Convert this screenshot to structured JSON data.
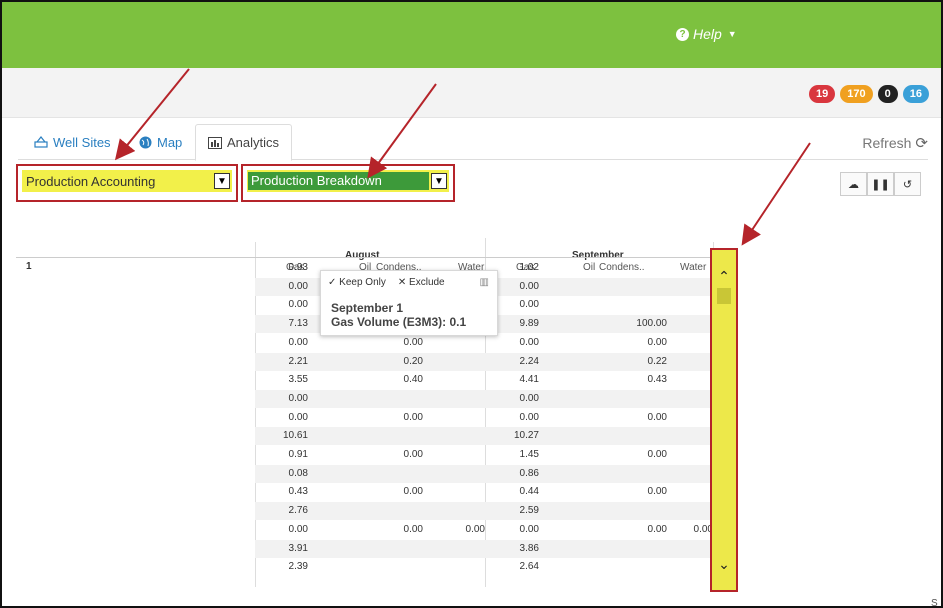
{
  "header": {
    "help_label": "Help",
    "help_icon": "question-circle-icon"
  },
  "badges": [
    {
      "value": "19",
      "color": "#d9363e"
    },
    {
      "value": "170",
      "color": "#f0a020"
    },
    {
      "value": "0",
      "color": "#222222"
    },
    {
      "value": "16",
      "color": "#3aa0d8"
    }
  ],
  "tabs": [
    {
      "label": "Well Sites",
      "icon": "well-icon"
    },
    {
      "label": "Map",
      "icon": "globe-icon"
    },
    {
      "label": "Analytics",
      "icon": "bar-chart-icon",
      "active": true
    }
  ],
  "refresh_label": "Refresh",
  "dropdowns": {
    "report": "Production Accounting",
    "view": "Production Breakdown"
  },
  "colors": {
    "highlight_yellow": "#f2f04a",
    "highlight_green": "#3d9a3a",
    "annotation_red": "#b5242a",
    "brand_green": "#7dc13f"
  },
  "grid": {
    "months": [
      "August",
      "September"
    ],
    "columns": [
      "Gas",
      "Oil",
      "Condens..",
      "Water"
    ],
    "row_label": "1",
    "rows": [
      {
        "aug": [
          "0.93",
          "",
          "",
          ""
        ],
        "sep": [
          "1.02",
          "",
          "",
          ""
        ]
      },
      {
        "aug": [
          "0.00",
          "",
          "",
          ""
        ],
        "sep": [
          "0.00",
          "",
          "",
          ""
        ]
      },
      {
        "aug": [
          "0.00",
          "",
          "",
          ""
        ],
        "sep": [
          "0.00",
          "",
          "",
          ""
        ]
      },
      {
        "aug": [
          "7.13",
          "",
          "",
          ""
        ],
        "sep": [
          "9.89",
          "",
          "100.00",
          ""
        ]
      },
      {
        "aug": [
          "0.00",
          "",
          "0.00",
          ""
        ],
        "sep": [
          "0.00",
          "",
          "0.00",
          ""
        ]
      },
      {
        "aug": [
          "2.21",
          "",
          "0.20",
          ""
        ],
        "sep": [
          "2.24",
          "",
          "0.22",
          ""
        ]
      },
      {
        "aug": [
          "3.55",
          "",
          "0.40",
          ""
        ],
        "sep": [
          "4.41",
          "",
          "0.43",
          ""
        ]
      },
      {
        "aug": [
          "0.00",
          "",
          "",
          ""
        ],
        "sep": [
          "0.00",
          "",
          "",
          ""
        ]
      },
      {
        "aug": [
          "0.00",
          "",
          "0.00",
          ""
        ],
        "sep": [
          "0.00",
          "",
          "0.00",
          ""
        ]
      },
      {
        "aug": [
          "10.61",
          "",
          "",
          ""
        ],
        "sep": [
          "10.27",
          "",
          "",
          ""
        ]
      },
      {
        "aug": [
          "0.91",
          "",
          "0.00",
          ""
        ],
        "sep": [
          "1.45",
          "",
          "0.00",
          ""
        ]
      },
      {
        "aug": [
          "0.08",
          "",
          "",
          ""
        ],
        "sep": [
          "0.86",
          "",
          "",
          ""
        ]
      },
      {
        "aug": [
          "0.43",
          "",
          "0.00",
          ""
        ],
        "sep": [
          "0.44",
          "",
          "0.00",
          ""
        ]
      },
      {
        "aug": [
          "2.76",
          "",
          "",
          ""
        ],
        "sep": [
          "2.59",
          "",
          "",
          ""
        ]
      },
      {
        "aug": [
          "0.00",
          "",
          "0.00",
          "0.00"
        ],
        "sep": [
          "0.00",
          "",
          "0.00",
          "0.00"
        ]
      },
      {
        "aug": [
          "3.91",
          "",
          "",
          ""
        ],
        "sep": [
          "3.86",
          "",
          "",
          ""
        ]
      },
      {
        "aug": [
          "2.39",
          "",
          "",
          ""
        ],
        "sep": [
          "2.64",
          "",
          "",
          ""
        ]
      }
    ]
  },
  "tooltip": {
    "keep_only": "Keep Only",
    "exclude": "Exclude",
    "title": "September 1",
    "detail": "Gas Volume (E3M3): 0.1"
  },
  "corner_text": "S"
}
